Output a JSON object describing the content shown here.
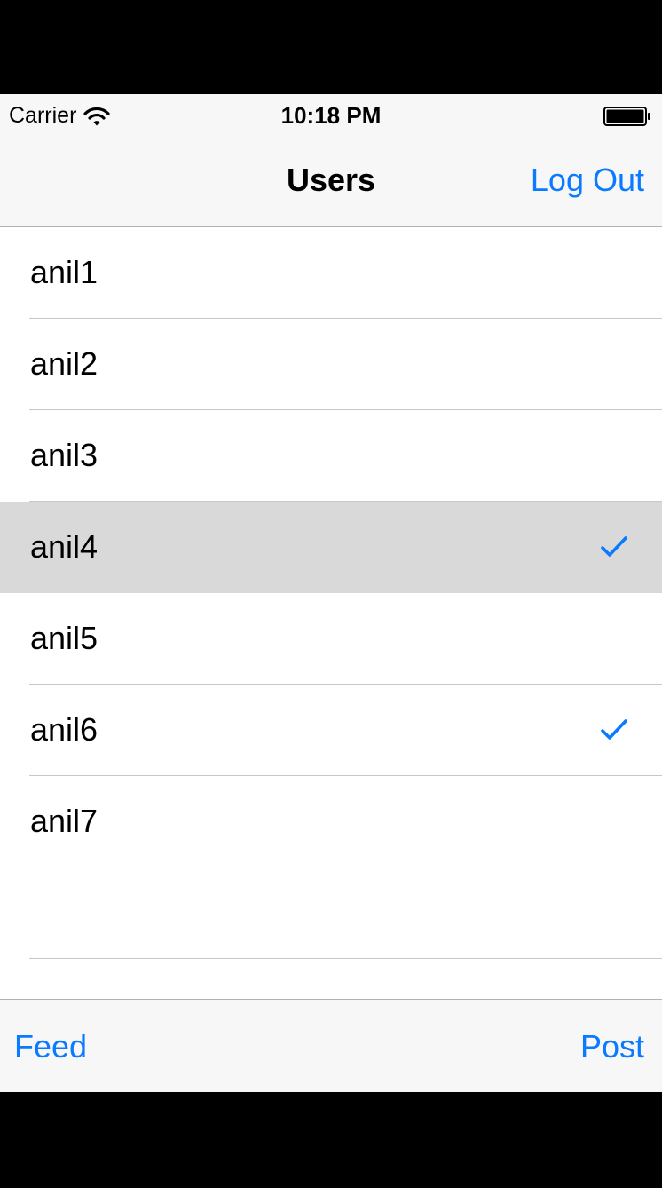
{
  "status_bar": {
    "carrier": "Carrier",
    "time": "10:18 PM"
  },
  "nav": {
    "title": "Users",
    "logout_label": "Log Out"
  },
  "users": [
    {
      "name": "anil1",
      "checked": false,
      "highlighted": false
    },
    {
      "name": "anil2",
      "checked": false,
      "highlighted": false
    },
    {
      "name": "anil3",
      "checked": false,
      "highlighted": false
    },
    {
      "name": "anil4",
      "checked": true,
      "highlighted": true
    },
    {
      "name": "anil5",
      "checked": false,
      "highlighted": false
    },
    {
      "name": "anil6",
      "checked": true,
      "highlighted": false
    },
    {
      "name": "anil7",
      "checked": false,
      "highlighted": false
    },
    {
      "name": "",
      "checked": false,
      "highlighted": false
    }
  ],
  "toolbar": {
    "feed_label": "Feed",
    "post_label": "Post"
  },
  "colors": {
    "accent": "#0a7afe",
    "bar_background": "#f7f7f7",
    "selected_row": "#d9d9d9",
    "separator": "#c8c7cc"
  },
  "icons": {
    "wifi": "wifi-icon",
    "battery": "battery-icon",
    "check": "checkmark-icon"
  }
}
